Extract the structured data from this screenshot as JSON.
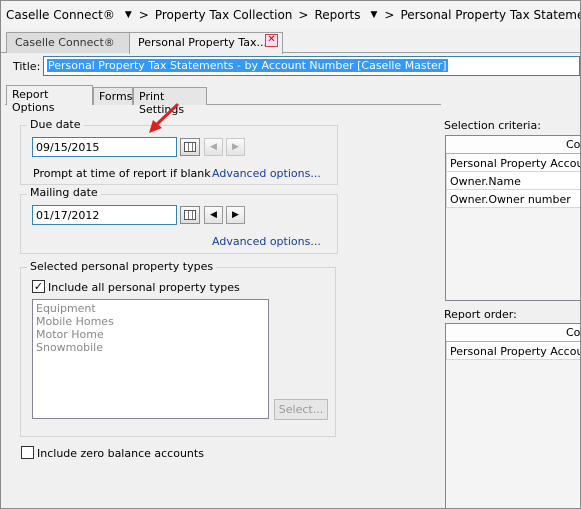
{
  "breadcrumb": [
    "Caselle Connect®",
    "Property Tax Collection",
    "Reports",
    "Personal Property Tax Statements"
  ],
  "doc_tabs": [
    "Caselle Connect®",
    "Personal Property Tax..."
  ],
  "title": {
    "label": "Title:",
    "value": "Personal Property Tax Statements - by Account Number [Caselle Master]"
  },
  "option_tabs": [
    "Report Options",
    "Forms",
    "Print Settings"
  ],
  "due_date": {
    "group_label": "Due date",
    "value": "09/15/2015",
    "prompt_text": "Prompt at time of report if blank",
    "advanced_link": "Advanced options..."
  },
  "mailing_date": {
    "group_label": "Mailing date",
    "value": "01/17/2012",
    "advanced_link": "Advanced options..."
  },
  "property_types": {
    "group_label": "Selected personal property types",
    "include_all_label": "Include all personal property types",
    "include_all_checked": true,
    "items": [
      "Equipment",
      "Mobile Homes",
      "Motor Home",
      "Snowmobile"
    ],
    "select_button": "Select..."
  },
  "zero_balance": {
    "label": "Include zero balance accounts",
    "checked": false
  },
  "selection_criteria": {
    "label": "Selection criteria:",
    "column_header": "Column",
    "rows": [
      "Personal Property Account...",
      "Owner.Name",
      "Owner.Owner number"
    ]
  },
  "report_order": {
    "label": "Report order:",
    "column_header": "Column",
    "rows": [
      "Personal Property Account..."
    ]
  },
  "icons": {
    "dropdown": "chevron-down-icon",
    "calendar": "calendar-icon",
    "prev": "chevron-left-icon",
    "next": "chevron-right-icon",
    "close": "close-icon",
    "check": "check-icon"
  },
  "colors": {
    "selection": "#3399ff",
    "link": "#1a3c9c",
    "annotation_arrow": "#e02020"
  }
}
